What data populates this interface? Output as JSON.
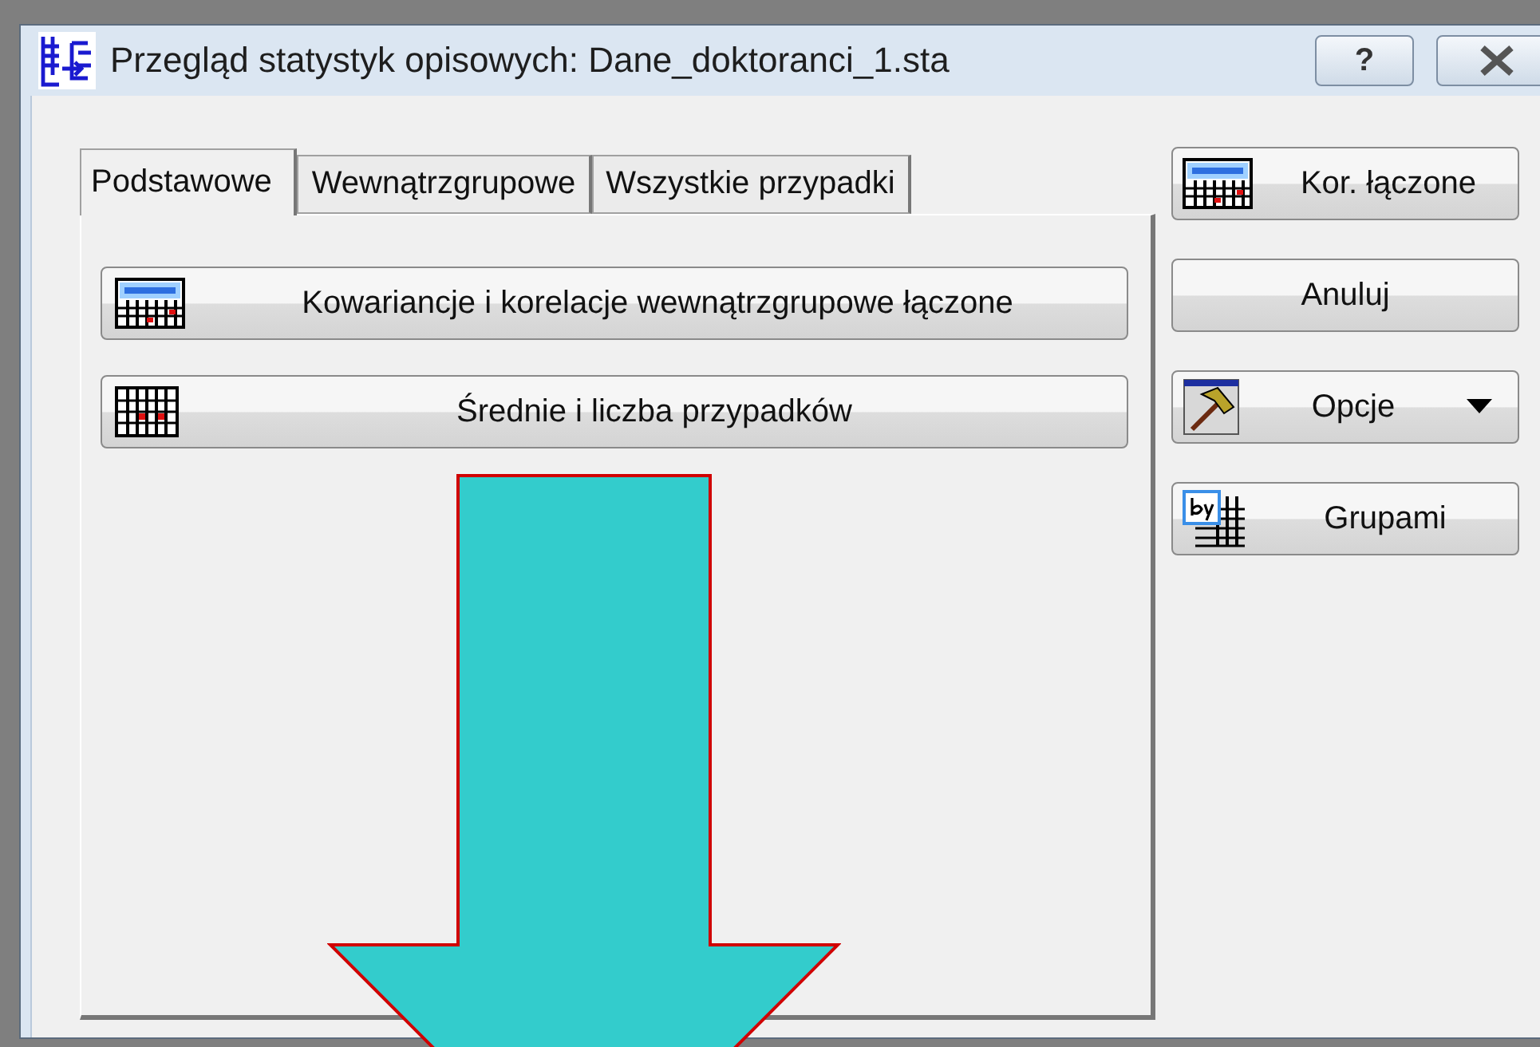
{
  "window": {
    "title": "Przegląd statystyk opisowych: Dane_doktoranci_1.sta",
    "help": "?"
  },
  "tabs": [
    {
      "label": "Podstawowe",
      "selected": true
    },
    {
      "label": "Wewnątrzgrupowe",
      "selected": false
    },
    {
      "label": "Wszystkie przypadki",
      "selected": false
    }
  ],
  "panel_buttons": [
    {
      "label": "Kowariancje i korelacje wewnątrzgrupowe łączone",
      "kind": "summary"
    },
    {
      "label": "Średnie i liczba przypadków",
      "kind": "grid"
    }
  ],
  "side_buttons": [
    {
      "label": "Kor. łączone",
      "kind": "summary",
      "menu": false
    },
    {
      "label": "Anuluj",
      "kind": "plain",
      "menu": false
    },
    {
      "label": "Opcje",
      "kind": "hammer",
      "menu": true
    },
    {
      "label": "Grupami",
      "kind": "by",
      "menu": false
    }
  ]
}
